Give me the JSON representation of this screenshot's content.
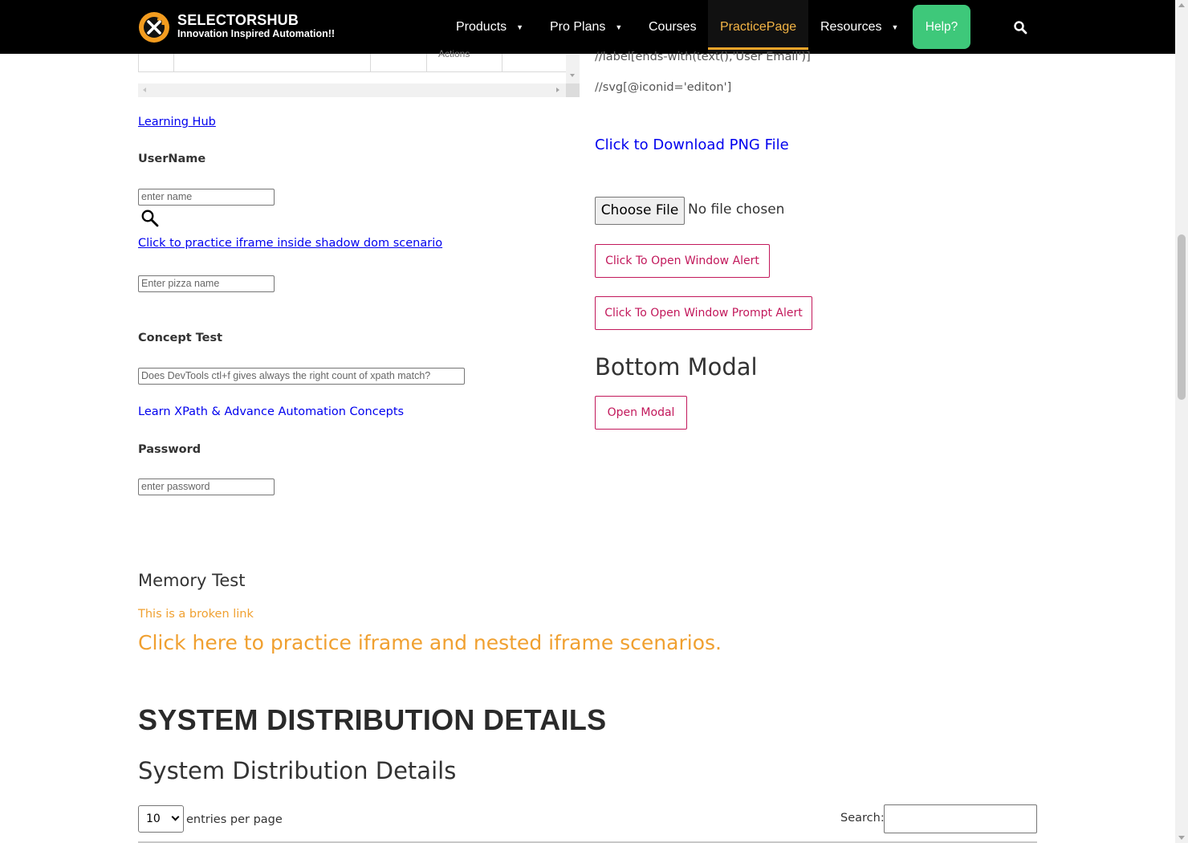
{
  "header": {
    "brand_name": "SELECTORSHUB",
    "brand_tagline": "Innovation Inspired Automation!!",
    "nav": [
      {
        "label": "Products",
        "has_caret": true
      },
      {
        "label": "Pro Plans",
        "has_caret": true
      },
      {
        "label": "Courses",
        "has_caret": false
      },
      {
        "label": "PracticePage",
        "has_caret": false,
        "active": true
      },
      {
        "label": "Resources",
        "has_caret": true
      }
    ],
    "help_label": "Help?",
    "search_icon": "search-icon"
  },
  "left": {
    "table_fragment_text": "Actions",
    "learning_hub_link": "Learning Hub",
    "username_label": "UserName",
    "username_placeholder": "enter name",
    "shadow_iframe_link": "Click to practice iframe inside shadow dom scenario",
    "pizza_placeholder": "Enter pizza name",
    "concept_label": "Concept Test",
    "concept_placeholder": "Does DevTools ctl+f gives always the right count of xpath match?",
    "xpath_link": "Learn XPath & Advance Automation Concepts",
    "password_label": "Password",
    "password_placeholder": "enter password"
  },
  "right": {
    "xpath_line1": "//label[ends-with(text(),'User Email')]",
    "xpath_line2": "//svg[@iconid='editon']",
    "download_link": "Click to Download PNG File",
    "choose_file_label": "Choose File",
    "no_file_text": "No file chosen",
    "window_alert_btn": "Click To Open Window Alert",
    "window_prompt_btn": "Click To Open Window Prompt Alert",
    "bottom_modal_heading": "Bottom Modal",
    "open_modal_btn": "Open Modal"
  },
  "lower": {
    "memory_heading": "Memory Test",
    "broken_link": "This is a broken link",
    "iframe_link": "Click here to practice iframe and nested iframe scenarios.",
    "sys_heading_caps": "SYSTEM DISTRIBUTION DETAILS",
    "sys_heading": "System Distribution Details",
    "entries_value": "10",
    "entries_text": "entries per page",
    "search_label": "Search:"
  },
  "colors": {
    "header_bg": "#000000",
    "active_nav": "#f4b545",
    "help_btn": "#3ec87a",
    "pink_btn": "#c2185b",
    "link_blue": "#0000ee",
    "orange_link": "#f0a030"
  }
}
